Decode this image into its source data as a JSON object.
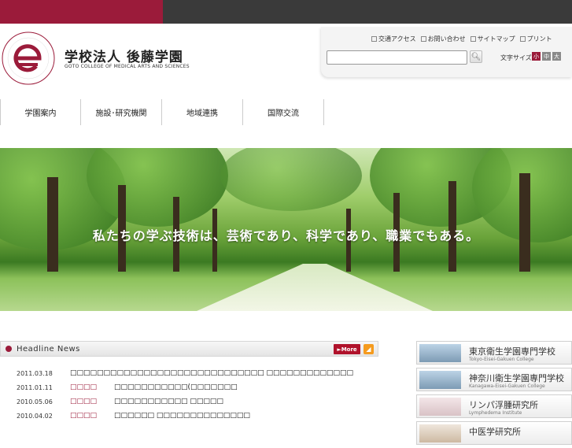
{
  "header": {
    "org_name": "学校法人 後藤学園",
    "org_name_en": "GOTO COLLEGE OF MEDICAL ARTS AND SCIENCES",
    "logo_ring_text": "GOTO COLLEGE OF MEDICAL ARTS AND SCIENCES"
  },
  "utility": {
    "links": [
      {
        "label": "交通アクセス",
        "icon": "map-icon"
      },
      {
        "label": "お問い合わせ",
        "icon": "mail-icon"
      },
      {
        "label": "サイトマップ",
        "icon": "sitemap-icon"
      },
      {
        "label": "プリント",
        "icon": "print-icon"
      }
    ],
    "search_value": "",
    "font_size_label": "文字サイズ",
    "font_sizes": [
      "小",
      "中",
      "大"
    ]
  },
  "nav": {
    "items": [
      "学園案内",
      "施設･研究機関",
      "地域連携",
      "国際交流"
    ]
  },
  "hero": {
    "tagline": "私たちの学ぶ技術は、芸術であり、科学であり、職業でもある。"
  },
  "news": {
    "title": "Headline News",
    "more_label": "More",
    "items": [
      {
        "date": "2011.03.18",
        "category": "",
        "text": "□□□□□□□□□□□□□□□□□□□□□□□□□□□□□ □□□□□□□□□□□□□"
      },
      {
        "date": "2011.01.11",
        "category": "□□□□",
        "text": "□□□□□□□□□□□(□□□□□□□"
      },
      {
        "date": "2010.05.06",
        "category": "□□□□",
        "text": "□□□□□□□□□□□ □□□□□"
      },
      {
        "date": "2010.04.02",
        "category": "□□□□",
        "text": "□□□□□□ □□□□□□□□□□□□□□"
      }
    ]
  },
  "side_links": [
    {
      "name": "東京衛生学園専門学校",
      "name_en": "Tokyo-Eisei-Gakuen College"
    },
    {
      "name": "神奈川衛生学園専門学校",
      "name_en": "Kanagawa-Eisei-Gakuen College"
    },
    {
      "name": "リンパ浮腫研究所",
      "name_en": "Lymphedema Institute"
    },
    {
      "name": "中医学研究所",
      "name_en": ""
    }
  ],
  "colors": {
    "brand": "#9b1b3a",
    "topbar": "#3a3a3a",
    "more_button": "#b0122b",
    "rss": "#f59b1e"
  }
}
